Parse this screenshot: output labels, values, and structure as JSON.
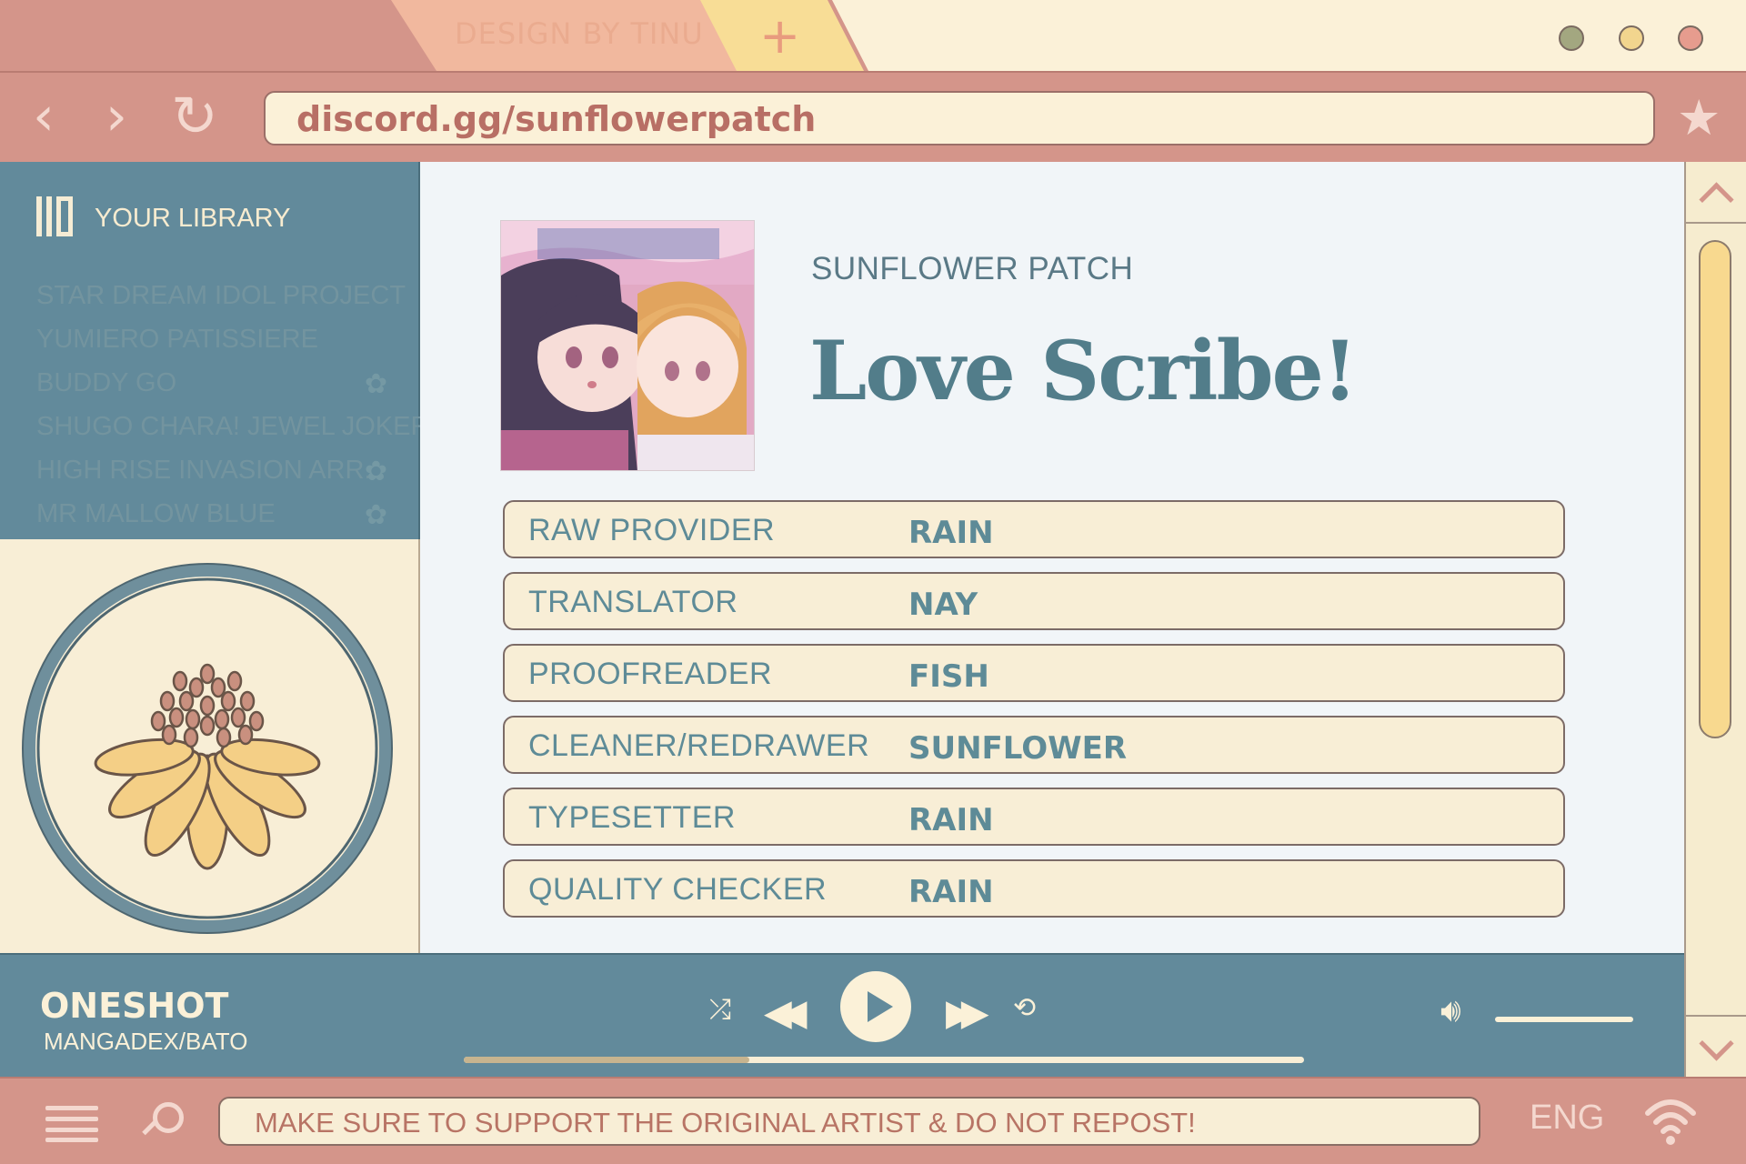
{
  "browser": {
    "tab_label": "DESIGN BY TINU",
    "new_tab_symbol": "+",
    "window_controls": [
      "minimize",
      "maximize",
      "close"
    ],
    "address": "discord.gg/sunflowerpatch",
    "nav_icons": {
      "back": "back-arrow-icon",
      "forward": "forward-arrow-icon",
      "reload": "reload-icon",
      "bookmark": "star-icon"
    }
  },
  "sidebar": {
    "title": "YOUR LIBRARY",
    "items": [
      {
        "label": "STAR DREAM IDOL PROJECT",
        "flower": false
      },
      {
        "label": "YUMIERO PATISSIERE",
        "flower": false
      },
      {
        "label": "BUDDY GO",
        "flower": true
      },
      {
        "label": "SHUGO CHARA! JEWEL JOKER",
        "flower": false
      },
      {
        "label": "HIGH RISE INVASION ARR...",
        "flower": true
      },
      {
        "label": "MR MALLOW BLUE",
        "flower": true
      }
    ]
  },
  "main": {
    "group": "SUNFLOWER PATCH",
    "title": "Love Scribe!",
    "credits": [
      {
        "role": "RAW PROVIDER",
        "name": "RAIN"
      },
      {
        "role": "TRANSLATOR",
        "name": "NAY"
      },
      {
        "role": "PROOFREADER",
        "name": "FISH"
      },
      {
        "role": "CLEANER/REDRAWER",
        "name": "SUNFLOWER"
      },
      {
        "role": "TYPESETTER",
        "name": "RAIN"
      },
      {
        "role": "QUALITY CHECKER",
        "name": "RAIN"
      }
    ]
  },
  "player": {
    "title": "ONESHOT",
    "subtitle": "MANGADEX/BATO",
    "progress": 0.34,
    "volume": 1.0
  },
  "taskbar": {
    "notice": "MAKE SURE TO SUPPORT THE ORIGINAL ARTIST & DO NOT REPOST!",
    "language": "ENG"
  },
  "colors": {
    "frame": "#d4958a",
    "teal": "#628a9b",
    "cream": "#f8eed6",
    "yellow": "#f8d98f",
    "content_bg": "#f1f5f8"
  }
}
